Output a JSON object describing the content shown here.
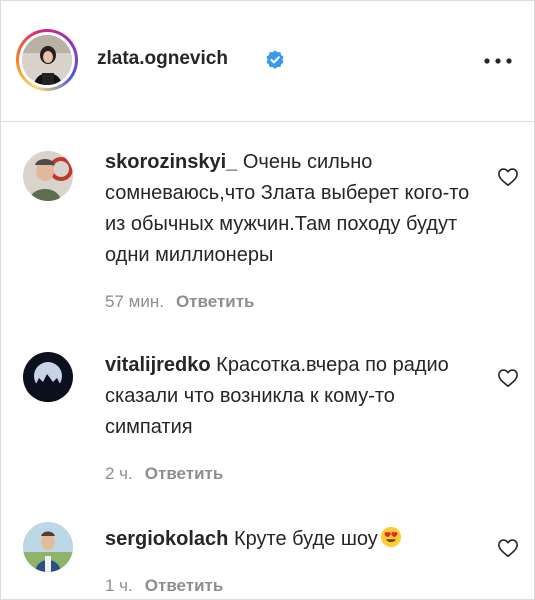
{
  "post": {
    "author": "zlata.ognevich",
    "verified_icon": "verified-badge-icon",
    "more_icon": "more-options-icon"
  },
  "comments": [
    {
      "username": "skorozinskyi_",
      "text": "Очень сильно сомневаюсь,что Злата выберет кого-то из обычных мужчин.Там походу будут одни миллионеры",
      "time": "57 мин.",
      "reply_label": "Ответить"
    },
    {
      "username": "vitalijredko",
      "text": "Красотка.вчера по радио сказали что возникла к кому-то симпатия",
      "time": "2 ч.",
      "reply_label": "Ответить"
    },
    {
      "username": "sergiokolach",
      "text": "Круте буде шоу",
      "emoji": "heart-eyes-emoji",
      "time": "1 ч.",
      "reply_label": "Ответить"
    }
  ],
  "colors": {
    "text": "#262626",
    "muted": "#8e8e8e",
    "verified": "#3897f0",
    "divider": "#dbdbdb"
  }
}
